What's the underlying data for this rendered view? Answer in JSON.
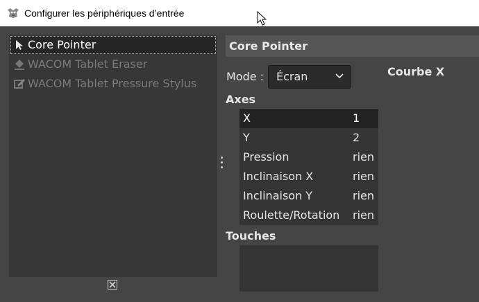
{
  "window": {
    "title": "Configurer les périphériques d’entrée"
  },
  "devices": [
    {
      "label": "Core Pointer",
      "icon": "pointer-arrow-icon",
      "state": "selected"
    },
    {
      "label": "WACOM Tablet Eraser",
      "icon": "eraser-icon",
      "state": "disabled"
    },
    {
      "label": "WACOM Tablet Pressure Stylus",
      "icon": "stylus-icon",
      "state": "disabled"
    }
  ],
  "detail": {
    "header": "Core Pointer",
    "mode_label": "Mode :",
    "mode_value": "Écran",
    "curve_title": "Courbe X",
    "axes_title": "Axes",
    "axes": [
      {
        "name": "X",
        "value": "1"
      },
      {
        "name": "Y",
        "value": "2"
      },
      {
        "name": "Pression",
        "value": "rien"
      },
      {
        "name": "Inclinaison X",
        "value": "rien"
      },
      {
        "name": "Inclinaison Y",
        "value": "rien"
      },
      {
        "name": "Roulette/Rotation",
        "value": "rien"
      }
    ],
    "keys_title": "Touches"
  },
  "colors": {
    "background": "#454545",
    "list_bg": "#373737",
    "selected_bg": "#262626",
    "header_bg": "#565656"
  }
}
